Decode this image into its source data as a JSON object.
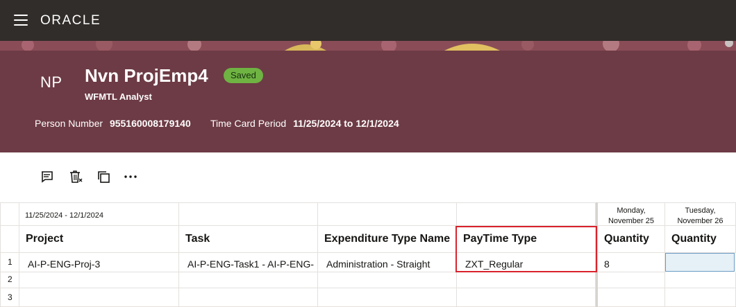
{
  "app": {
    "brand": "ORACLE"
  },
  "header": {
    "initials": "NP",
    "name": "Nvn ProjEmp4",
    "status": "Saved",
    "role": "WFMTL Analyst",
    "person_number_label": "Person Number",
    "person_number": "955160008179140",
    "period_label": "Time Card Period",
    "period": "11/25/2024 to 12/1/2024"
  },
  "toolbar": {
    "icons": [
      "comment-icon",
      "delete-icon",
      "copy-icon",
      "more-icon"
    ]
  },
  "grid": {
    "period_range": "11/25/2024 - 12/1/2024",
    "day_headers": [
      {
        "line1": "Monday,",
        "line2": "November 25"
      },
      {
        "line1": "Tuesday,",
        "line2": "November 26"
      }
    ],
    "columns": [
      "Project",
      "Task",
      "Expenditure Type Name",
      "PayTime Type",
      "Quantity",
      "Quantity"
    ],
    "rows": [
      {
        "num": "1",
        "project": "AI-P-ENG-Proj-3",
        "task": "AI-P-ENG-Task1 - AI-P-ENG-",
        "expenditure": "Administration - Straight",
        "paytime": "ZXT_Regular",
        "qty_mon": "8",
        "qty_tue": ""
      },
      {
        "num": "2",
        "project": "",
        "task": "",
        "expenditure": "",
        "paytime": "",
        "qty_mon": "",
        "qty_tue": ""
      },
      {
        "num": "3",
        "project": "",
        "task": "",
        "expenditure": "",
        "paytime": "",
        "qty_mon": "",
        "qty_tue": ""
      }
    ]
  },
  "colors": {
    "topbar": "#312d2a",
    "banner": "#6d3b45",
    "badge": "#6fb343",
    "highlight": "#d9222c"
  }
}
